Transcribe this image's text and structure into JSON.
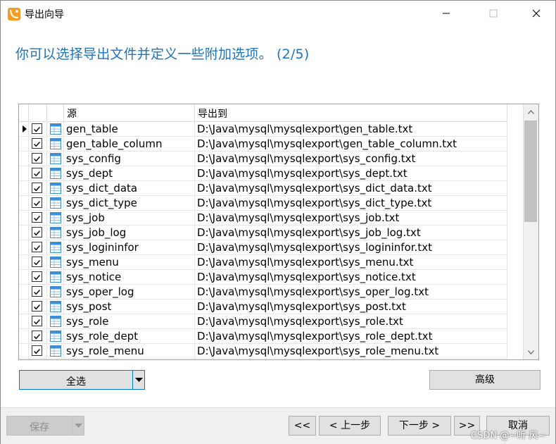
{
  "window": {
    "title": "导出向导",
    "heading": "你可以选择导出文件并定义一些附加选项。 (2/5)"
  },
  "grid": {
    "columns": {
      "source": "源",
      "export_to": "导出到"
    },
    "rows": [
      {
        "source": "gen_table",
        "dest": "D:\\Java\\mysql\\mysqlexport\\gen_table.txt",
        "checked": true,
        "current": true
      },
      {
        "source": "gen_table_column",
        "dest": "D:\\Java\\mysql\\mysqlexport\\gen_table_column.txt",
        "checked": true
      },
      {
        "source": "sys_config",
        "dest": "D:\\Java\\mysql\\mysqlexport\\sys_config.txt",
        "checked": true
      },
      {
        "source": "sys_dept",
        "dest": "D:\\Java\\mysql\\mysqlexport\\sys_dept.txt",
        "checked": true
      },
      {
        "source": "sys_dict_data",
        "dest": "D:\\Java\\mysql\\mysqlexport\\sys_dict_data.txt",
        "checked": true
      },
      {
        "source": "sys_dict_type",
        "dest": "D:\\Java\\mysql\\mysqlexport\\sys_dict_type.txt",
        "checked": true
      },
      {
        "source": "sys_job",
        "dest": "D:\\Java\\mysql\\mysqlexport\\sys_job.txt",
        "checked": true
      },
      {
        "source": "sys_job_log",
        "dest": "D:\\Java\\mysql\\mysqlexport\\sys_job_log.txt",
        "checked": true
      },
      {
        "source": "sys_logininfor",
        "dest": "D:\\Java\\mysql\\mysqlexport\\sys_logininfor.txt",
        "checked": true
      },
      {
        "source": "sys_menu",
        "dest": "D:\\Java\\mysql\\mysqlexport\\sys_menu.txt",
        "checked": true
      },
      {
        "source": "sys_notice",
        "dest": "D:\\Java\\mysql\\mysqlexport\\sys_notice.txt",
        "checked": true
      },
      {
        "source": "sys_oper_log",
        "dest": "D:\\Java\\mysql\\mysqlexport\\sys_oper_log.txt",
        "checked": true
      },
      {
        "source": "sys_post",
        "dest": "D:\\Java\\mysql\\mysqlexport\\sys_post.txt",
        "checked": true
      },
      {
        "source": "sys_role",
        "dest": "D:\\Java\\mysql\\mysqlexport\\sys_role.txt",
        "checked": true
      },
      {
        "source": "sys_role_dept",
        "dest": "D:\\Java\\mysql\\mysqlexport\\sys_role_dept.txt",
        "checked": true
      },
      {
        "source": "sys_role_menu",
        "dest": "D:\\Java\\mysql\\mysqlexport\\sys_role_menu.txt",
        "checked": true
      }
    ]
  },
  "buttons": {
    "select_all": "全选",
    "advanced": "高级",
    "save": "保存",
    "first": "<<",
    "prev": "< 上一步",
    "next": "下一步 >",
    "last": ">>",
    "cancel": "取消"
  },
  "watermark": "CSDN @~听 风~",
  "icons": {
    "app": "navicat-app-icon",
    "table": "table-icon",
    "minimize": "minimize-icon",
    "maximize": "maximize-icon",
    "close": "close-icon"
  },
  "colors": {
    "heading": "#1e73be",
    "focus_border": "#0078d7",
    "app_icon": "#f59a23",
    "table_icon": "#3b8fd9"
  }
}
